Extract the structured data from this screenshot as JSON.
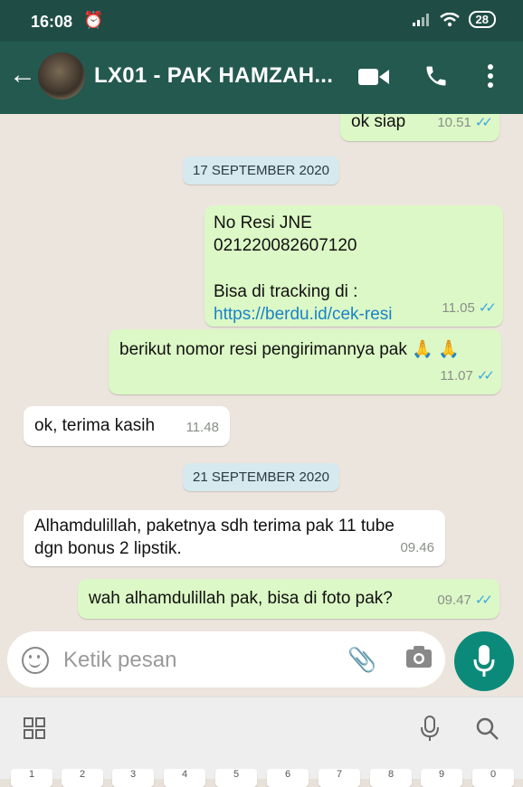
{
  "status_bar": {
    "time": "16:08",
    "battery": "28"
  },
  "header": {
    "title": "LX01 - PAK HAMZAH..."
  },
  "messages": [
    {
      "text": "ok siap",
      "time": "10.51"
    },
    {
      "date": "17 SEPTEMBER 2020"
    },
    {
      "line1": "No Resi JNE",
      "line2": "021220082607120",
      "line3": "Bisa di tracking di :",
      "link": "https://berdu.id/cek-resi",
      "time": "11.05"
    },
    {
      "text": "berikut nomor resi pengirimannya pak 🙏 🙏",
      "time": "11.07"
    },
    {
      "text": "ok, terima kasih",
      "time": "11.48"
    },
    {
      "date": "21 SEPTEMBER 2020"
    },
    {
      "line1": "Alhamdulillah, paketnya sdh terima pak 11 tube",
      "line2": "dgn bonus 2 lipstik.",
      "time": "09.46"
    },
    {
      "text": "wah alhamdulillah pak, bisa di foto pak?",
      "time": "09.47"
    }
  ],
  "input": {
    "placeholder": "Ketik pesan"
  },
  "keyboard": {
    "keys": [
      "1",
      "2",
      "3",
      "4",
      "5",
      "6",
      "7",
      "8",
      "9",
      "0"
    ]
  },
  "colors": {
    "header": "#24594f",
    "outgoing": "#dcf8c6",
    "incoming": "#ffffff",
    "send_button": "#0b8a7a",
    "read_ticks": "#3aa7e5"
  }
}
